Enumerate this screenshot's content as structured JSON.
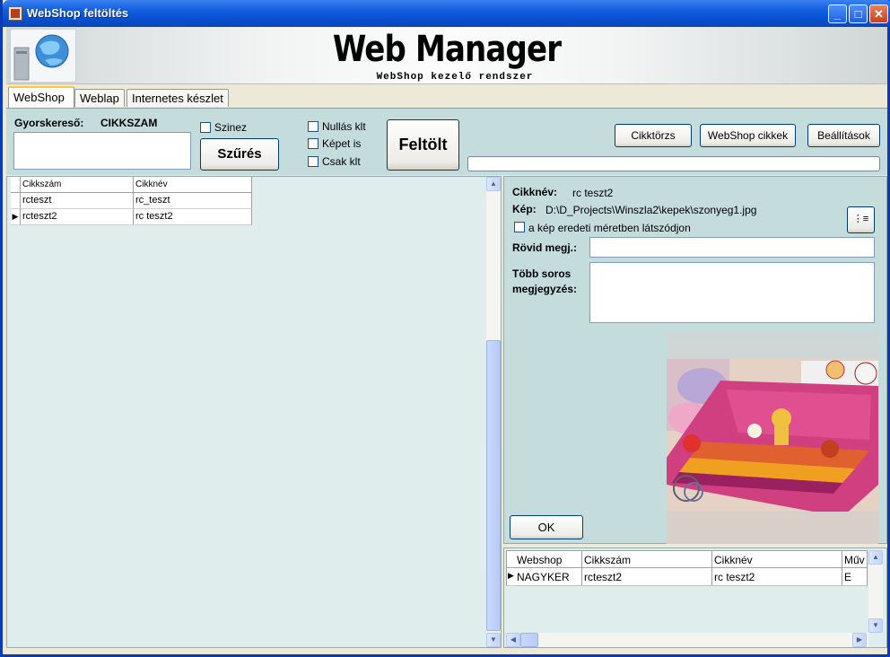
{
  "window": {
    "title": "WebShop feltöltés",
    "minimize": "_",
    "maximize": "□",
    "close": "✕"
  },
  "banner": {
    "title": "Web Manager",
    "subtitle": "WebShop kezelő rendszer"
  },
  "tabs": [
    {
      "label": "WebShop",
      "active": true
    },
    {
      "label": "Weblap"
    },
    {
      "label": "Internetes készlet"
    }
  ],
  "search": {
    "label": "Gyorskereső:",
    "field": "CIKKSZAM",
    "value": ""
  },
  "filters": {
    "szinez": "Szinez",
    "nullas": "Nullás klt",
    "kepet": "Képet is",
    "csak": "Csak klt",
    "szures": "Szűrés",
    "feltolt": "Feltölt"
  },
  "toolbar": {
    "cikktorzs": "Cikktörzs",
    "webshop_cikkek": "WebShop cikkek",
    "beallitasok": "Beállítások",
    "progress": 0
  },
  "left_grid": {
    "headers": [
      "Cikkszám",
      "Cikknév"
    ],
    "rows": [
      [
        "rcteszt",
        "rc_teszt"
      ],
      [
        "rcteszt2",
        "rc teszt2"
      ]
    ],
    "selected_index": 1,
    "selected_marker": "▶"
  },
  "detail": {
    "cikknev_label": "Cikknév:",
    "cikknev": "rc teszt2",
    "kep_label": "Kép:",
    "kep": "D:\\D_Projects\\Winszla2\\kepek\\szonyeg1.jpg",
    "original_size": "a kép eredeti méretben látszódjon",
    "rovid_label": "Rövid megj.:",
    "rovid": "",
    "tobb_label1": "Több soros",
    "tobb_label2": "megjegyzés:",
    "tobb": "",
    "ok": "OK"
  },
  "bottom_grid": {
    "headers": [
      "Webshop",
      "Cikkszám",
      "Cikknév",
      "Műv"
    ],
    "rows": [
      [
        "NAGYKER",
        "rcteszt2",
        "rc teszt2",
        "E"
      ]
    ],
    "selected_marker": "▶"
  },
  "scroll_arrows": {
    "up": "▲",
    "down": "▼",
    "left": "◀",
    "right": "▶"
  }
}
